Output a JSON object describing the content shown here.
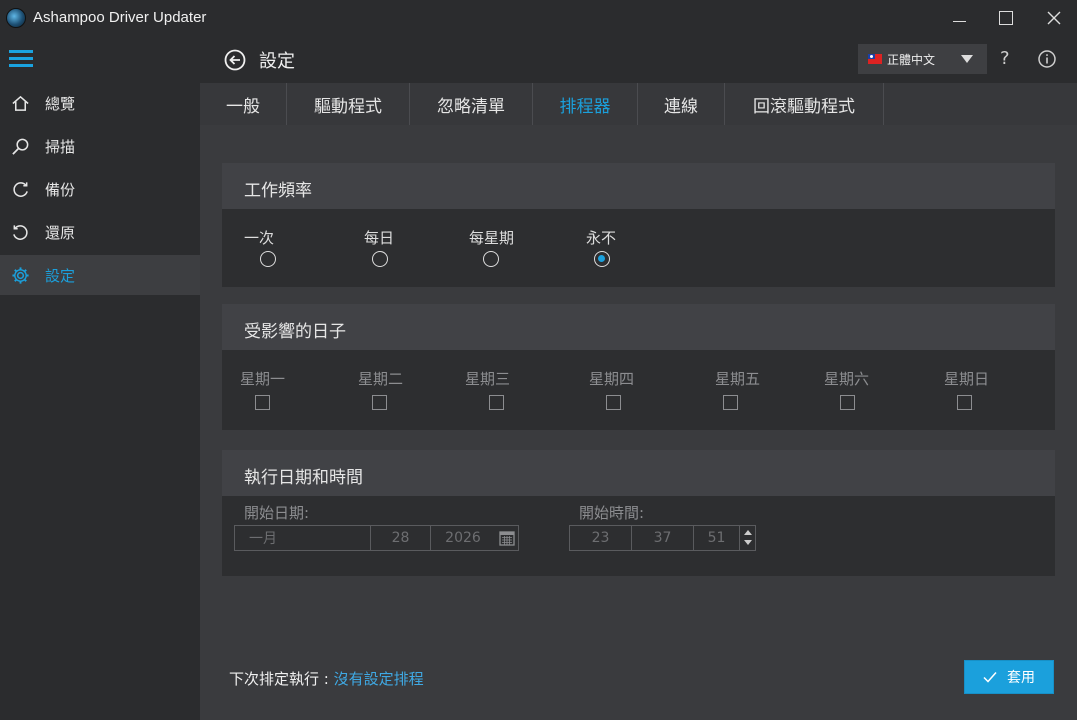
{
  "window": {
    "title": "Ashampoo Driver Updater"
  },
  "sidebar": {
    "items": [
      {
        "label": "總覽",
        "icon": "home-icon"
      },
      {
        "label": "掃描",
        "icon": "search-icon"
      },
      {
        "label": "備份",
        "icon": "backup-icon"
      },
      {
        "label": "還原",
        "icon": "restore-icon"
      },
      {
        "label": "設定",
        "icon": "gear-icon",
        "active": true
      }
    ]
  },
  "header": {
    "title": "設定",
    "language": "正體中文",
    "help": "?"
  },
  "tabs": [
    {
      "label": "一般"
    },
    {
      "label": "驅動程式"
    },
    {
      "label": "忽略清單"
    },
    {
      "label": "排程器",
      "active": true
    },
    {
      "label": "連線"
    },
    {
      "label": "回滾驅動程式"
    }
  ],
  "frequency": {
    "title": "工作頻率",
    "options": [
      {
        "label": "一次",
        "checked": false
      },
      {
        "label": "每日",
        "checked": false
      },
      {
        "label": "每星期",
        "checked": false
      },
      {
        "label": "永不",
        "checked": true
      }
    ]
  },
  "days": {
    "title": "受影響的日子",
    "options": [
      {
        "label": "星期一",
        "checked": false
      },
      {
        "label": "星期二",
        "checked": false
      },
      {
        "label": "星期三",
        "checked": false
      },
      {
        "label": "星期四",
        "checked": false
      },
      {
        "label": "星期五",
        "checked": false
      },
      {
        "label": "星期六",
        "checked": false
      },
      {
        "label": "星期日",
        "checked": false
      }
    ]
  },
  "execution": {
    "title": "執行日期和時間",
    "start_date_label": "開始日期:",
    "start_date": {
      "month": "一月",
      "day": "28",
      "year": "2026"
    },
    "start_time_label": "開始時間:",
    "start_time": {
      "hour": "23",
      "minute": "37",
      "second": "51"
    }
  },
  "footer": {
    "next_run_label": "下次排定執行 : ",
    "next_run_value": "沒有設定排程",
    "apply_label": "套用"
  },
  "colors": {
    "accent": "#1ba0dc",
    "background": "#2b2c2e",
    "content": "#3a3b3e",
    "panel_body": "#2d2e30"
  }
}
